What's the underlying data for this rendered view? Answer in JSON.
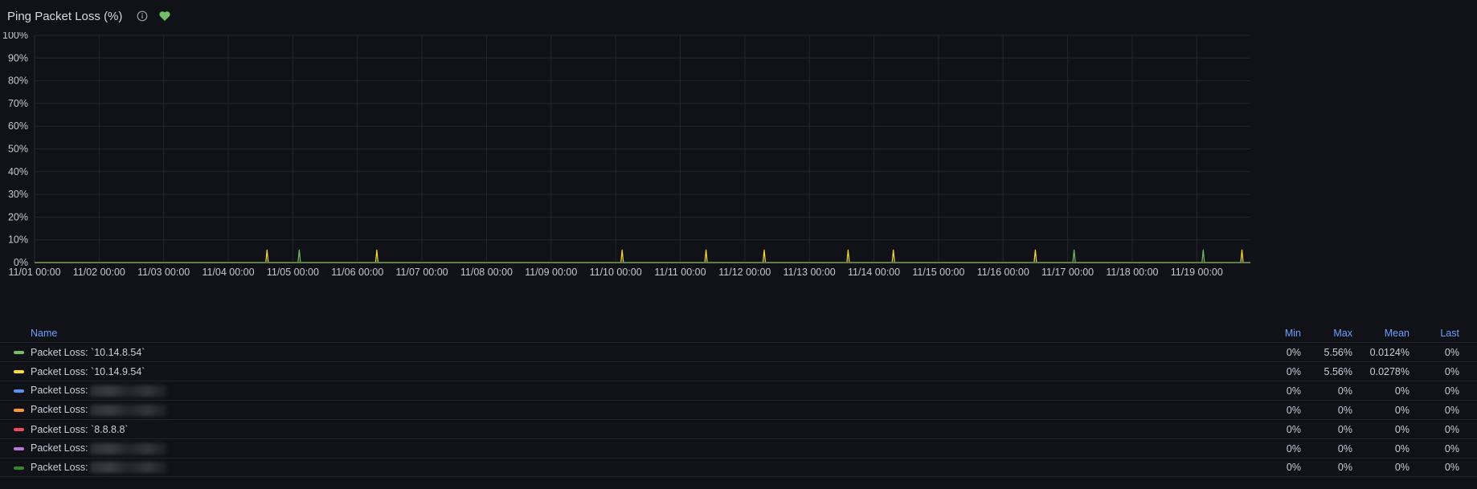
{
  "panel": {
    "title": "Ping Packet Loss (%)",
    "status_color": "#73bf69"
  },
  "chart_data": {
    "type": "line",
    "ylim": [
      0,
      100
    ],
    "y_ticks": [
      "0%",
      "10%",
      "20%",
      "30%",
      "40%",
      "50%",
      "60%",
      "70%",
      "80%",
      "90%",
      "100%"
    ],
    "x_ticks": [
      "11/01 00:00",
      "11/02 00:00",
      "11/03 00:00",
      "11/04 00:00",
      "11/05 00:00",
      "11/06 00:00",
      "11/07 00:00",
      "11/08 00:00",
      "11/09 00:00",
      "11/10 00:00",
      "11/11 00:00",
      "11/12 00:00",
      "11/13 00:00",
      "11/14 00:00",
      "11/15 00:00",
      "11/16 00:00",
      "11/17 00:00",
      "11/18 00:00",
      "11/19 00:00"
    ],
    "x_range_days": [
      0,
      18.7
    ],
    "grid": true,
    "legend_placement": "bottom",
    "series": [
      {
        "name": "Packet Loss: `10.14.8.54`",
        "color": "#73bf69",
        "spikes": [
          {
            "day": 4.1,
            "value": 5.56
          },
          {
            "day": 16.1,
            "value": 5.56
          },
          {
            "day": 18.1,
            "value": 5.56
          }
        ]
      },
      {
        "name": "Packet Loss: `10.14.9.54`",
        "color": "#fade2a",
        "spikes": [
          {
            "day": 3.6,
            "value": 5.56
          },
          {
            "day": 5.3,
            "value": 5.56
          },
          {
            "day": 9.1,
            "value": 5.56
          },
          {
            "day": 10.4,
            "value": 5.56
          },
          {
            "day": 11.3,
            "value": 5.56
          },
          {
            "day": 12.6,
            "value": 5.56
          },
          {
            "day": 13.3,
            "value": 5.56
          },
          {
            "day": 15.5,
            "value": 5.56
          },
          {
            "day": 18.7,
            "value": 5.56
          }
        ]
      },
      {
        "name": "Packet Loss:",
        "color": "#5794f2",
        "spikes": []
      },
      {
        "name": "Packet Loss:",
        "color": "#ff9830",
        "spikes": []
      },
      {
        "name": "Packet Loss: `8.8.8.8`",
        "color": "#f2495c",
        "spikes": []
      },
      {
        "name": "Packet Loss:",
        "color": "#b877d9",
        "spikes": []
      },
      {
        "name": "Packet Loss:",
        "color": "#37872d",
        "spikes": []
      }
    ]
  },
  "legend": {
    "headers": {
      "name": "Name",
      "min": "Min",
      "max": "Max",
      "mean": "Mean",
      "last": "Last"
    },
    "rows": [
      {
        "label": "Packet Loss: `10.14.8.54`",
        "redacted": false,
        "min": "0%",
        "max": "5.56%",
        "mean": "0.0124%",
        "last": "0%",
        "color": "#73bf69"
      },
      {
        "label": "Packet Loss: `10.14.9.54`",
        "redacted": false,
        "min": "0%",
        "max": "5.56%",
        "mean": "0.0278%",
        "last": "0%",
        "color": "#fade2a"
      },
      {
        "label": "Packet Loss:",
        "redacted": true,
        "min": "0%",
        "max": "0%",
        "mean": "0%",
        "last": "0%",
        "color": "#5794f2"
      },
      {
        "label": "Packet Loss:",
        "redacted": true,
        "min": "0%",
        "max": "0%",
        "mean": "0%",
        "last": "0%",
        "color": "#ff9830"
      },
      {
        "label": "Packet Loss: `8.8.8.8`",
        "redacted": false,
        "min": "0%",
        "max": "0%",
        "mean": "0%",
        "last": "0%",
        "color": "#f2495c"
      },
      {
        "label": "Packet Loss:",
        "redacted": true,
        "min": "0%",
        "max": "0%",
        "mean": "0%",
        "last": "0%",
        "color": "#b877d9"
      },
      {
        "label": "Packet Loss:",
        "redacted": true,
        "min": "0%",
        "max": "0%",
        "mean": "0%",
        "last": "0%",
        "color": "#37872d"
      }
    ]
  }
}
